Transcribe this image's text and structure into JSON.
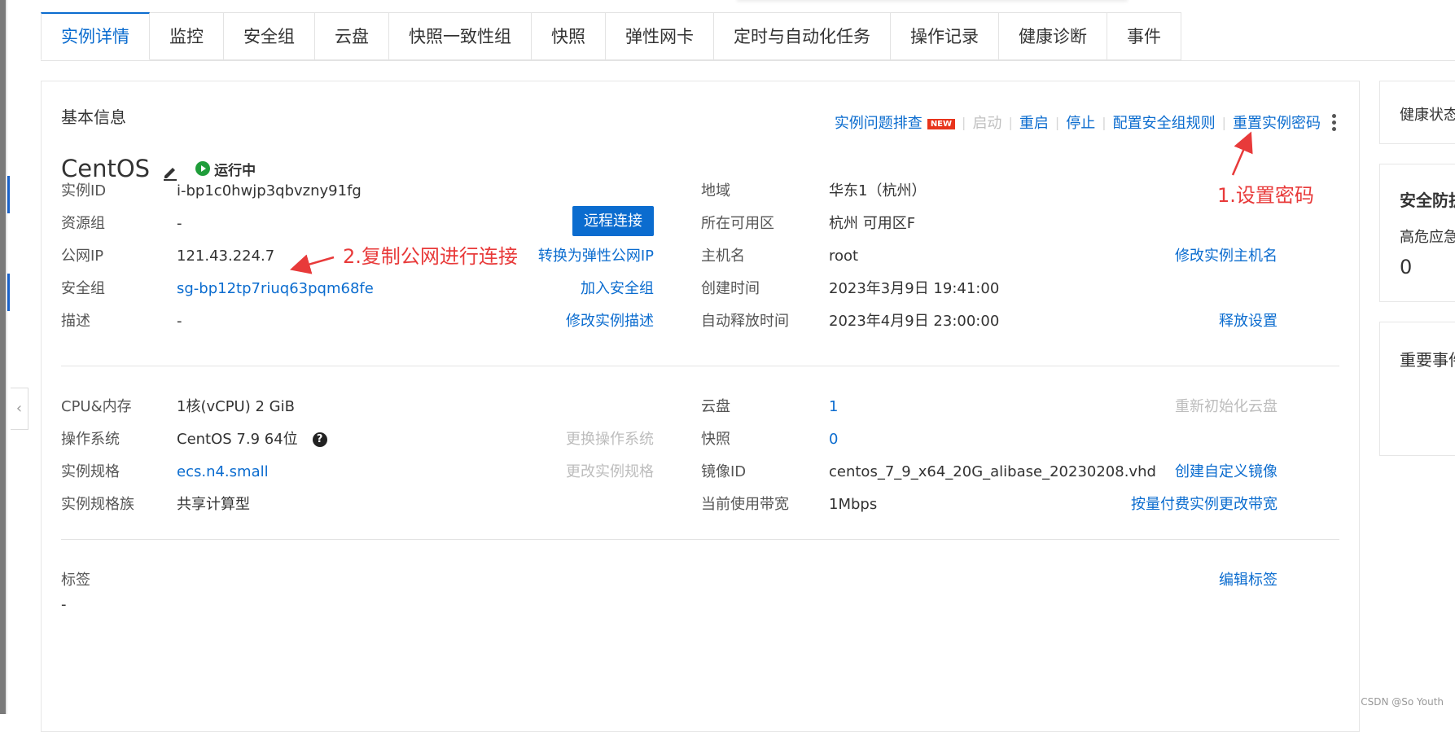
{
  "tabs": [
    {
      "label": "实例详情"
    },
    {
      "label": "监控"
    },
    {
      "label": "安全组"
    },
    {
      "label": "云盘"
    },
    {
      "label": "快照一致性组"
    },
    {
      "label": "快照"
    },
    {
      "label": "弹性网卡"
    },
    {
      "label": "定时与自动化任务"
    },
    {
      "label": "操作记录"
    },
    {
      "label": "健康诊断"
    },
    {
      "label": "事件"
    }
  ],
  "basic": {
    "title": "基本信息",
    "actions": {
      "troubleshoot": "实例问题排查",
      "new_badge": "NEW",
      "start": "启动",
      "restart": "重启",
      "stop": "停止",
      "config_sg": "配置安全组规则",
      "reset_pwd": "重置实例密码"
    },
    "instance_name": "CentOS",
    "status": "运行中",
    "remote_connect": "远程连接"
  },
  "left_fields": {
    "instance_id": {
      "label": "实例ID",
      "value": "i-bp1c0hwjp3qbvzny91fg"
    },
    "resource_group": {
      "label": "资源组",
      "value": "-"
    },
    "public_ip": {
      "label": "公网IP",
      "value": "121.43.224.7",
      "action": "转换为弹性公网IP"
    },
    "security_group": {
      "label": "安全组",
      "value": "sg-bp12tp7riuq63pqm68fe",
      "action": "加入安全组"
    },
    "description": {
      "label": "描述",
      "value": "-",
      "action": "修改实例描述"
    }
  },
  "right_fields": {
    "region": {
      "label": "地域",
      "value": "华东1（杭州）"
    },
    "zone": {
      "label": "所在可用区",
      "value": "杭州 可用区F"
    },
    "hostname": {
      "label": "主机名",
      "value": "root",
      "action": "修改实例主机名"
    },
    "created": {
      "label": "创建时间",
      "value": "2023年3月9日 19:41:00"
    },
    "auto_release": {
      "label": "自动释放时间",
      "value": "2023年4月9日 23:00:00",
      "action": "释放设置"
    }
  },
  "config_left": {
    "cpu_mem": {
      "label": "CPU&内存",
      "value": "1核(vCPU) 2 GiB"
    },
    "os": {
      "label": "操作系统",
      "value": "CentOS 7.9 64位",
      "help": "?",
      "action": "更换操作系统"
    },
    "spec": {
      "label": "实例规格",
      "value": "ecs.n4.small",
      "action": "更改实例规格"
    },
    "spec_family": {
      "label": "实例规格族",
      "value": "共享计算型"
    }
  },
  "config_right": {
    "disk": {
      "label": "云盘",
      "value": "1",
      "action": "重新初始化云盘"
    },
    "snapshot": {
      "label": "快照",
      "value": "0"
    },
    "image": {
      "label": "镜像ID",
      "value": "centos_7_9_x64_20G_alibase_20230208.vhd",
      "action": "创建自定义镜像"
    },
    "bandwidth": {
      "label": "当前使用带宽",
      "value": "1Mbps",
      "action": "按量付费实例更改带宽"
    }
  },
  "tags": {
    "label": "标签",
    "value": "-",
    "action": "编辑标签"
  },
  "annotations": {
    "step1": "1.设置密码",
    "step2": "2.复制公网进行连接"
  },
  "side_panels": {
    "health": "健康状态",
    "security": "安全防护",
    "high_risk": "高危应急",
    "high_risk_count": "0",
    "events": "重要事件"
  },
  "watermark": "CSDN @So Youth",
  "colors": {
    "accent": "#0b6ccf",
    "running": "#1f9d3a",
    "annotation": "#e83a3a",
    "new_badge": "#e8341c"
  }
}
